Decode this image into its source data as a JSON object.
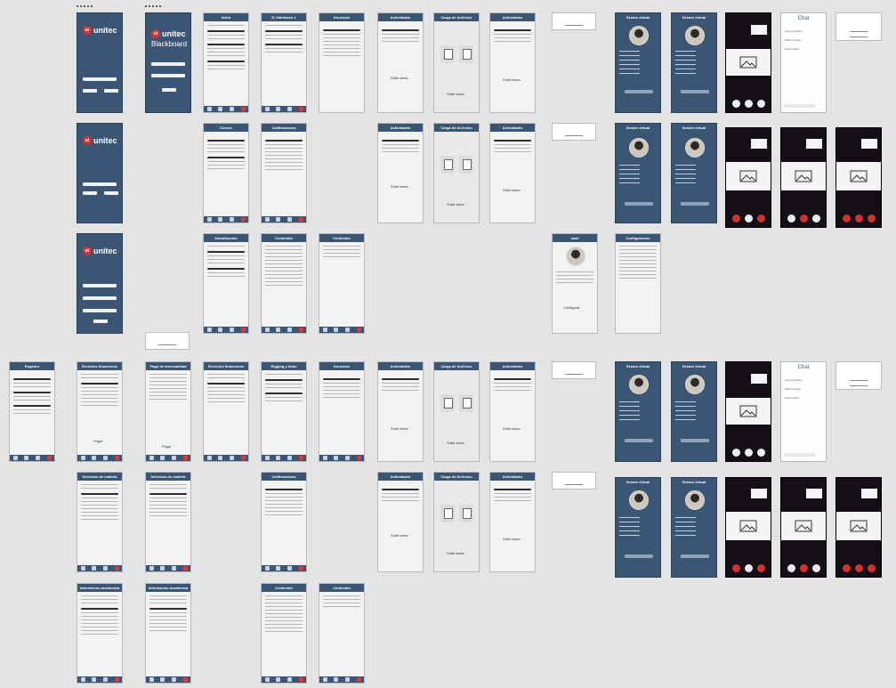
{
  "brand": {
    "logo_text": "unitec",
    "blackboard": "Blackboard",
    "accent": "#3b5575",
    "danger": "#d23232"
  },
  "headers": {
    "inicio": "Inicio",
    "disenio": "D. Interfaces 1",
    "anuncios": "Anuncios",
    "actividades": "Actividades",
    "carga": "Carga de Archivos",
    "cursos": "Cursos",
    "calificaciones": "Calificaciones",
    "actualizacion": "Actualización",
    "contenido": "Contenido",
    "sesion_virtual": "Sesion virtual",
    "chat": "Chat",
    "perfil": "nazli",
    "configuracion": "Configuracion",
    "registro": "Registro",
    "servicios": "Servicios financieros",
    "pago": "Pago de mensualidad",
    "rigging": "Rigging y Anim",
    "servicios_materia": "Servicios de materia",
    "info": "Informacion academica"
  },
  "buttons": {
    "subir_tarea": "Subir tarea",
    "pagar": "Pagar",
    "configurar": "Configurar"
  },
  "chat": {
    "names": [
      "Jorge Orellana",
      "Mario Zuniga",
      "Daniel Elias"
    ]
  },
  "icons": [
    "bell-icon",
    "home-icon",
    "chat-icon",
    "menu-icon",
    "logout-icon",
    "image-icon",
    "mic-icon",
    "camera-icon",
    "close-icon",
    "send-icon",
    "file-icon"
  ]
}
